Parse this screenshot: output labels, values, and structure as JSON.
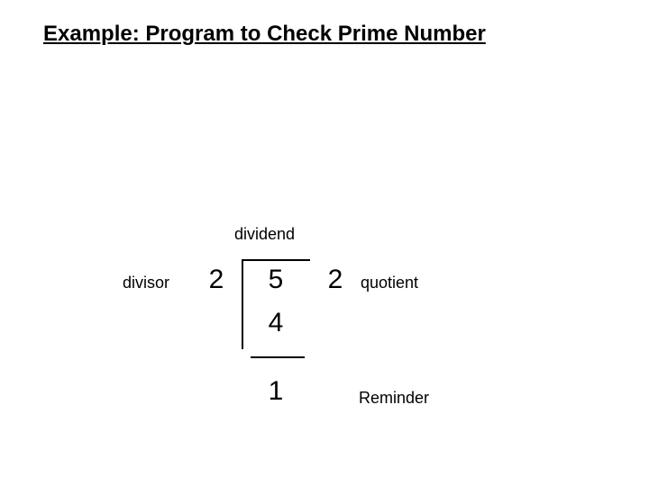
{
  "title": "Example: Program to Check Prime Number",
  "labels": {
    "dividend": "dividend",
    "divisor": "divisor",
    "quotient": "quotient",
    "reminder": "Reminder"
  },
  "values": {
    "divisor": "2",
    "dividend": "5",
    "quotient": "2",
    "multiple": "4",
    "remainder": "1"
  }
}
